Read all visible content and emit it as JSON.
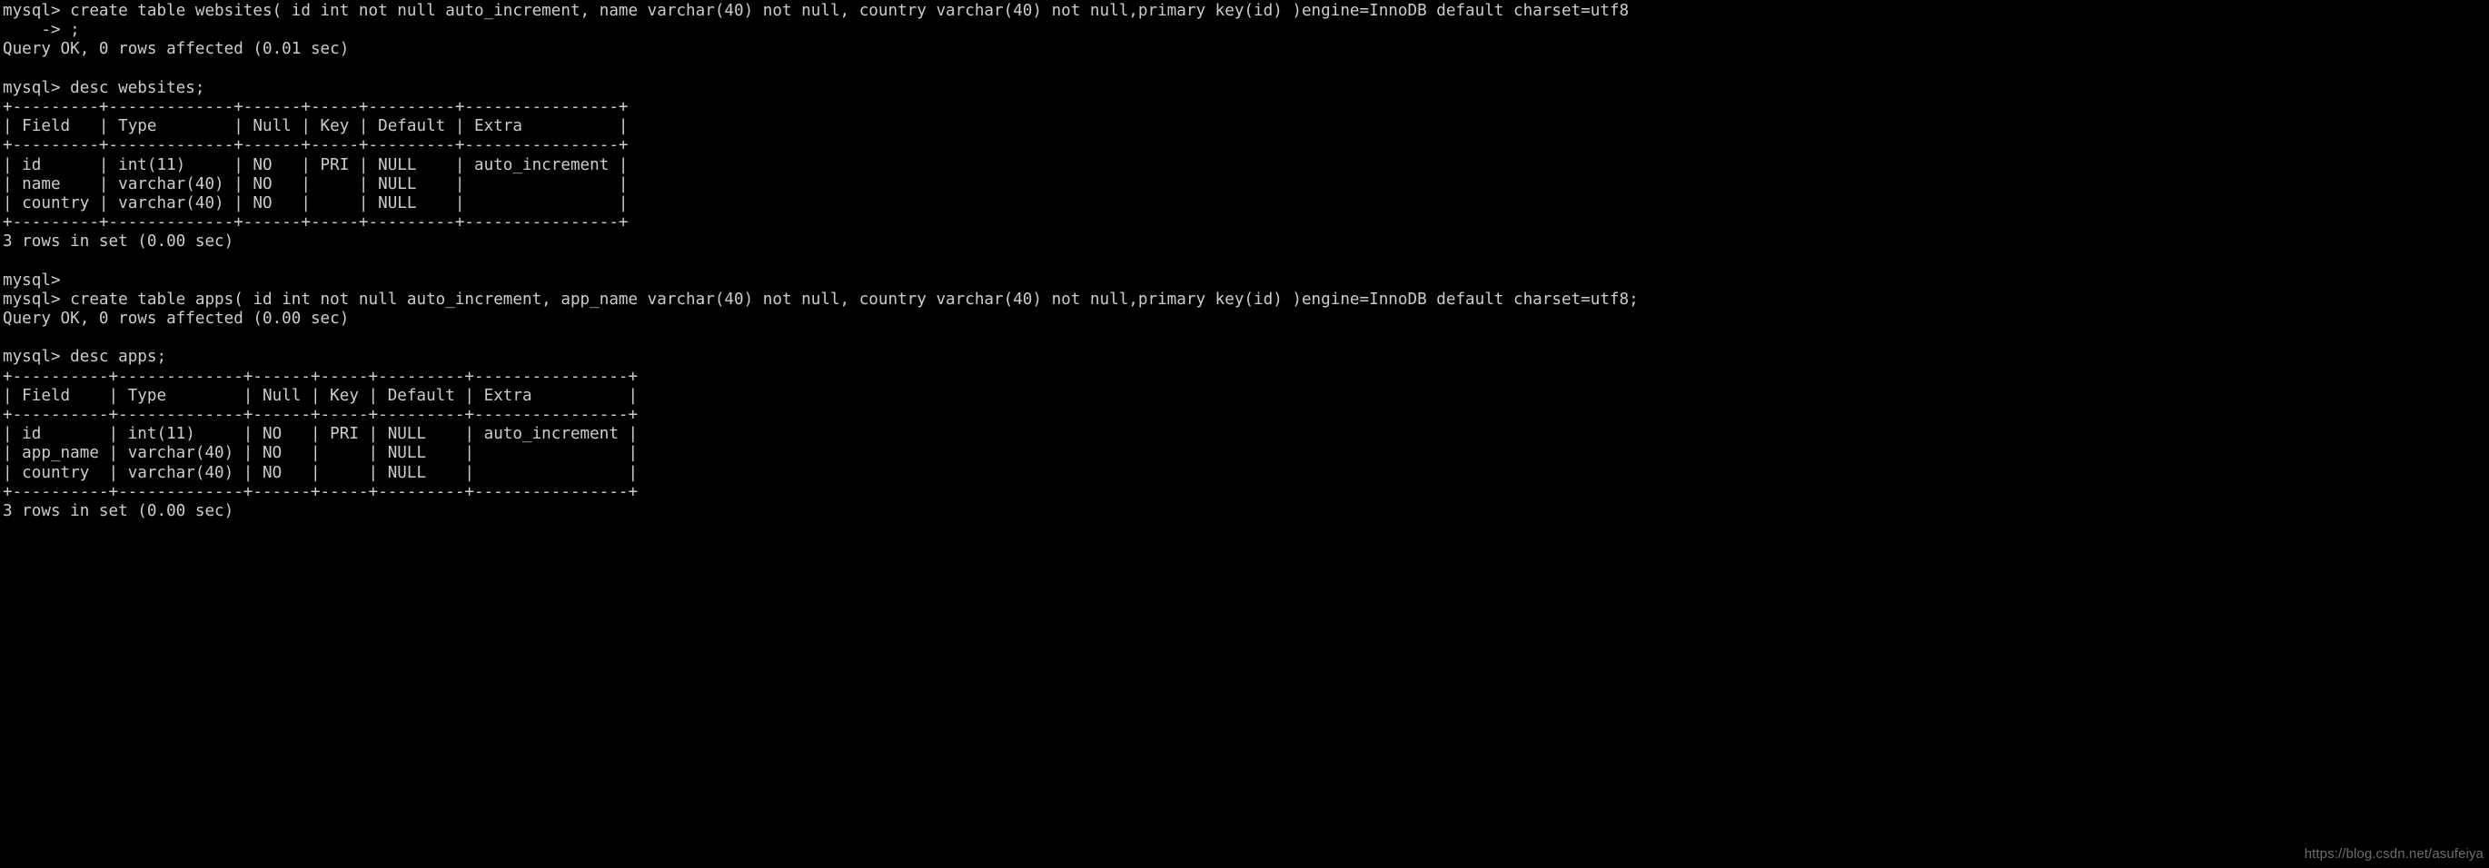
{
  "terminal": {
    "title": "mysql client session",
    "colors": {
      "background": "#000000",
      "foreground": "#ccccca",
      "watermark": "#6d6d6d"
    },
    "prompt": "mysql>",
    "continuation_prompt": "    ->",
    "lines": [
      "mysql> create table websites( id int not null auto_increment, name varchar(40) not null, country varchar(40) not null,primary key(id) )engine=InnoDB default charset=utf8",
      "    -> ;",
      "Query OK, 0 rows affected (0.01 sec)",
      "",
      "mysql> desc websites;",
      "+---------+-------------+------+-----+---------+----------------+",
      "| Field   | Type        | Null | Key | Default | Extra          |",
      "+---------+-------------+------+-----+---------+----------------+",
      "| id      | int(11)     | NO   | PRI | NULL    | auto_increment |",
      "| name    | varchar(40) | NO   |     | NULL    |                |",
      "| country | varchar(40) | NO   |     | NULL    |                |",
      "+---------+-------------+------+-----+---------+----------------+",
      "3 rows in set (0.00 sec)",
      "",
      "mysql>",
      "mysql> create table apps( id int not null auto_increment, app_name varchar(40) not null, country varchar(40) not null,primary key(id) )engine=InnoDB default charset=utf8;",
      "Query OK, 0 rows affected (0.00 sec)",
      "",
      "mysql> desc apps;",
      "+----------+-------------+------+-----+---------+----------------+",
      "| Field    | Type        | Null | Key | Default | Extra          |",
      "+----------+-------------+------+-----+---------+----------------+",
      "| id       | int(11)     | NO   | PRI | NULL    | auto_increment |",
      "| app_name | varchar(40) | NO   |     | NULL    |                |",
      "| country  | varchar(40) | NO   |     | NULL    |                |",
      "+----------+-------------+------+-----+---------+----------------+",
      "3 rows in set (0.00 sec)"
    ],
    "statements": [
      {
        "command": "create table websites( id int not null auto_increment, name varchar(40) not null, country varchar(40) not null,primary key(id) )engine=InnoDB default charset=utf8",
        "terminator": ";",
        "result": "Query OK, 0 rows affected (0.01 sec)"
      },
      {
        "command": "desc websites;",
        "result": "3 rows in set (0.00 sec)"
      },
      {
        "command": "create table apps( id int not null auto_increment, app_name varchar(40) not null, country varchar(40) not null,primary key(id) )engine=InnoDB default charset=utf8;",
        "result": "Query OK, 0 rows affected (0.00 sec)"
      },
      {
        "command": "desc apps;",
        "result": "3 rows in set (0.00 sec)"
      }
    ],
    "tables": [
      {
        "name": "websites",
        "headers": [
          "Field",
          "Type",
          "Null",
          "Key",
          "Default",
          "Extra"
        ],
        "rows": [
          [
            "id",
            "int(11)",
            "NO",
            "PRI",
            "NULL",
            "auto_increment"
          ],
          [
            "name",
            "varchar(40)",
            "NO",
            "",
            "NULL",
            ""
          ],
          [
            "country",
            "varchar(40)",
            "NO",
            "",
            "NULL",
            ""
          ]
        ],
        "row_count": "3 rows in set (0.00 sec)"
      },
      {
        "name": "apps",
        "headers": [
          "Field",
          "Type",
          "Null",
          "Key",
          "Default",
          "Extra"
        ],
        "rows": [
          [
            "id",
            "int(11)",
            "NO",
            "PRI",
            "NULL",
            "auto_increment"
          ],
          [
            "app_name",
            "varchar(40)",
            "NO",
            "",
            "NULL",
            ""
          ],
          [
            "country",
            "varchar(40)",
            "NO",
            "",
            "NULL",
            ""
          ]
        ],
        "row_count": "3 rows in set (0.00 sec)"
      }
    ]
  },
  "watermark": {
    "text": "https://blog.csdn.net/asufeiya"
  }
}
